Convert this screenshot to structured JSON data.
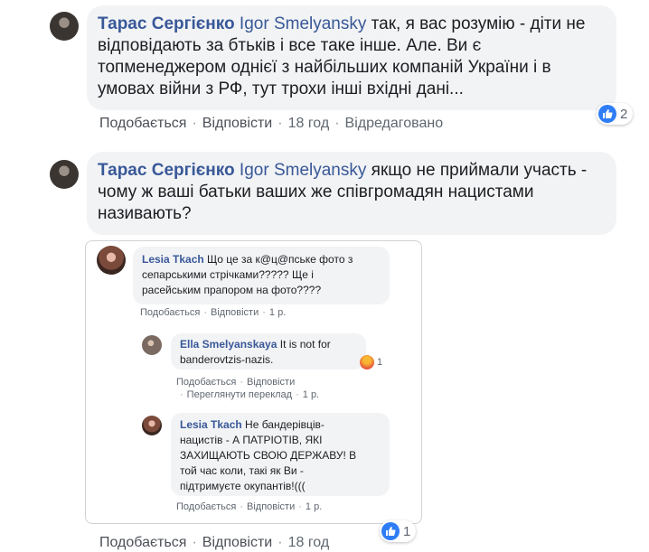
{
  "comments": [
    {
      "author": "Тарас Сергієнко",
      "mention": "Igor Smelyansky",
      "text_lines": [
        " так, я вас розумію - діти не",
        "відповідають за бтьків і все таке інше. Але. Ви є",
        "топменеджером однієї з найбільших компаній України і в",
        "умовах війни з РФ, тут трохи інші вхідні дані..."
      ],
      "like_label": "Подобається",
      "reply_label": "Відповісти",
      "time": "18 год",
      "edited_label": "Відредаговано",
      "reaction_count": "2"
    },
    {
      "author": "Тарас Сергієнко",
      "mention": "Igor Smelyansky",
      "text_lines": [
        " якщо не приймали участь -",
        "чому ж ваші батьки ваших же співгромадян нацистами",
        "називають?"
      ],
      "like_label": "Подобається",
      "reply_label": "Відповісти",
      "time": "18 год",
      "reaction_count": "1"
    }
  ],
  "embedded": {
    "comments": [
      {
        "author": "Lesia Tkach",
        "text_lines": [
          " Що це за к@ц@пське фото з",
          "сепарськими стрічками????? Ще і",
          "расейським прапором на фото????"
        ],
        "like_label": "Подобається",
        "reply_label": "Відповісти",
        "time": "1 р."
      },
      {
        "author": "Ella Smelyanskaya",
        "text_lines": [
          " It is not for",
          "banderovtzis-nazis."
        ],
        "like_label": "Подобається",
        "reply_label": "Відповісти",
        "translate_label": "Переглянути переклад",
        "time": "1 р.",
        "reaction_count": "1"
      },
      {
        "author": "Lesia Tkach",
        "text_lines": [
          " Не бандерівців-",
          "нацистів - А ПАТРІОТІВ, ЯКІ",
          "ЗАХИЩАЮТЬ СВОЮ ДЕРЖАВУ! В",
          "той час коли, такі як Ви -",
          "підтримуєте окупантів!((("
        ],
        "like_label": "Подобається",
        "reply_label": "Відповісти",
        "time": "1 р."
      }
    ]
  },
  "icons": {
    "like": "thumbs-up-icon",
    "angry": "angry-reaction-icon"
  },
  "colors": {
    "author": "#385898",
    "bubble": "#f2f3f5",
    "like_blue": "#2f7df6"
  }
}
